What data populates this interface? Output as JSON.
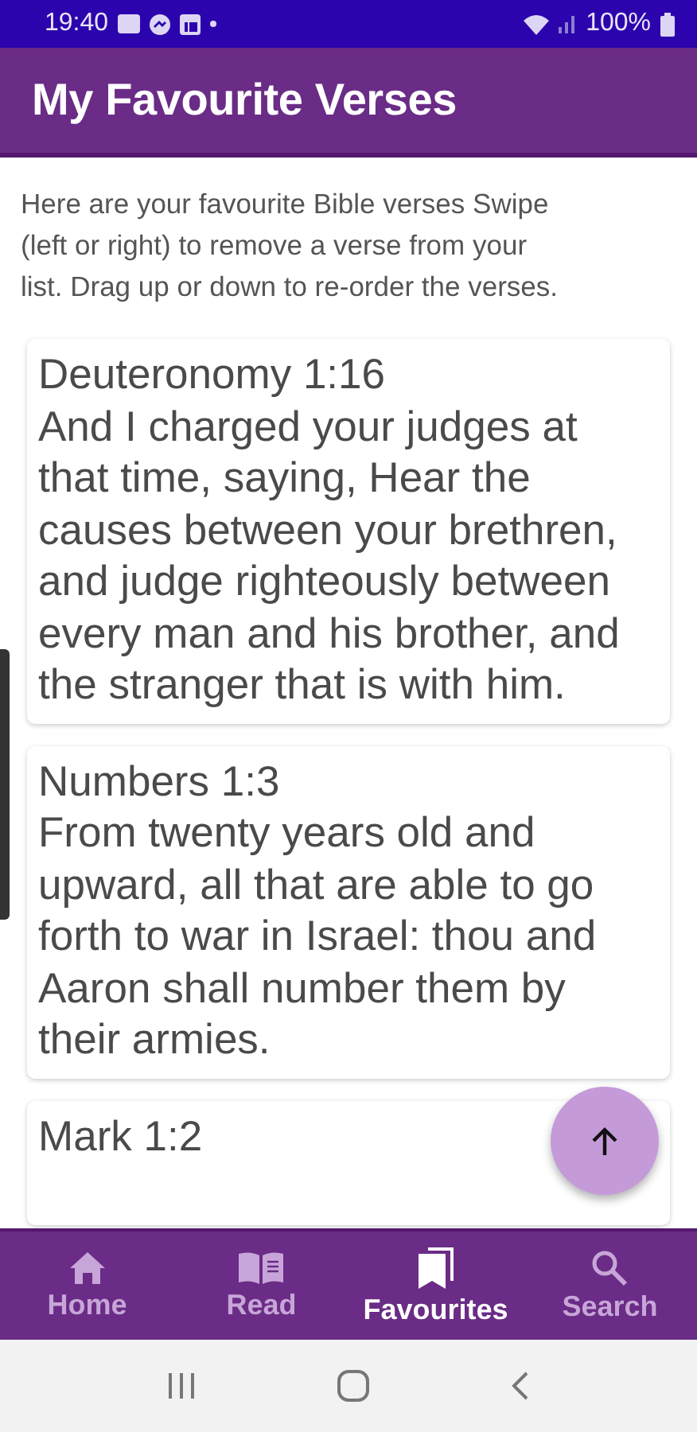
{
  "status_bar": {
    "time": "19:40",
    "battery": "100%"
  },
  "app_bar": {
    "title": "My Favourite Verses"
  },
  "intro": "Here are your favourite Bible verses Swipe (left or right) to remove a verse from your list. Drag up or down to re-order the verses.",
  "verses": [
    {
      "reference": "Deuteronomy 1:16",
      "text": "And I charged your judges at that time, saying, Hear the causes between your brethren, and judge righteously between every man and his brother, and the stranger that is with him."
    },
    {
      "reference": "Numbers 1:3",
      "text": "From twenty years old and upward, all that are able to go forth to war in Israel: thou and Aaron shall number them by their armies."
    },
    {
      "reference": "Mark 1:2"
    }
  ],
  "bottom_nav": [
    {
      "label": "Home",
      "selected": false
    },
    {
      "label": "Read",
      "selected": false
    },
    {
      "label": "Favourites",
      "selected": true
    },
    {
      "label": "Search",
      "selected": false
    }
  ]
}
